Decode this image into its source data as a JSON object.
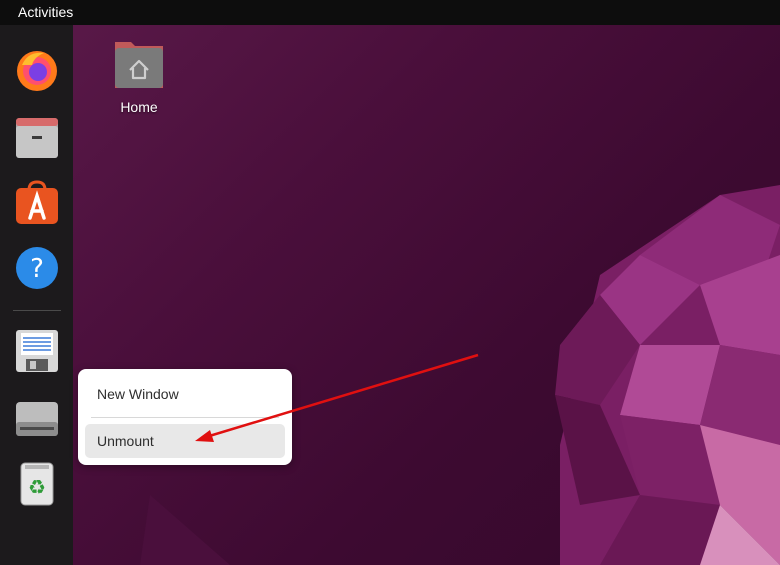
{
  "topbar": {
    "activities_label": "Activities"
  },
  "desktop": {
    "icons": [
      {
        "label": "Home",
        "icon": "home-folder-icon"
      }
    ]
  },
  "dock": {
    "items": [
      {
        "name": "firefox",
        "icon": "firefox-icon"
      },
      {
        "name": "files",
        "icon": "files-icon"
      },
      {
        "name": "software",
        "icon": "software-store-icon"
      },
      {
        "name": "help",
        "icon": "help-icon"
      },
      {
        "name": "floppy",
        "icon": "floppy-disk-icon"
      },
      {
        "name": "drive",
        "icon": "drive-icon"
      },
      {
        "name": "trash",
        "icon": "trash-icon"
      }
    ]
  },
  "context_menu": {
    "items": [
      {
        "label": "New Window"
      },
      {
        "label": "Unmount"
      }
    ]
  },
  "colors": {
    "annotation_arrow": "#e01010",
    "accent_orange": "#e95420"
  }
}
